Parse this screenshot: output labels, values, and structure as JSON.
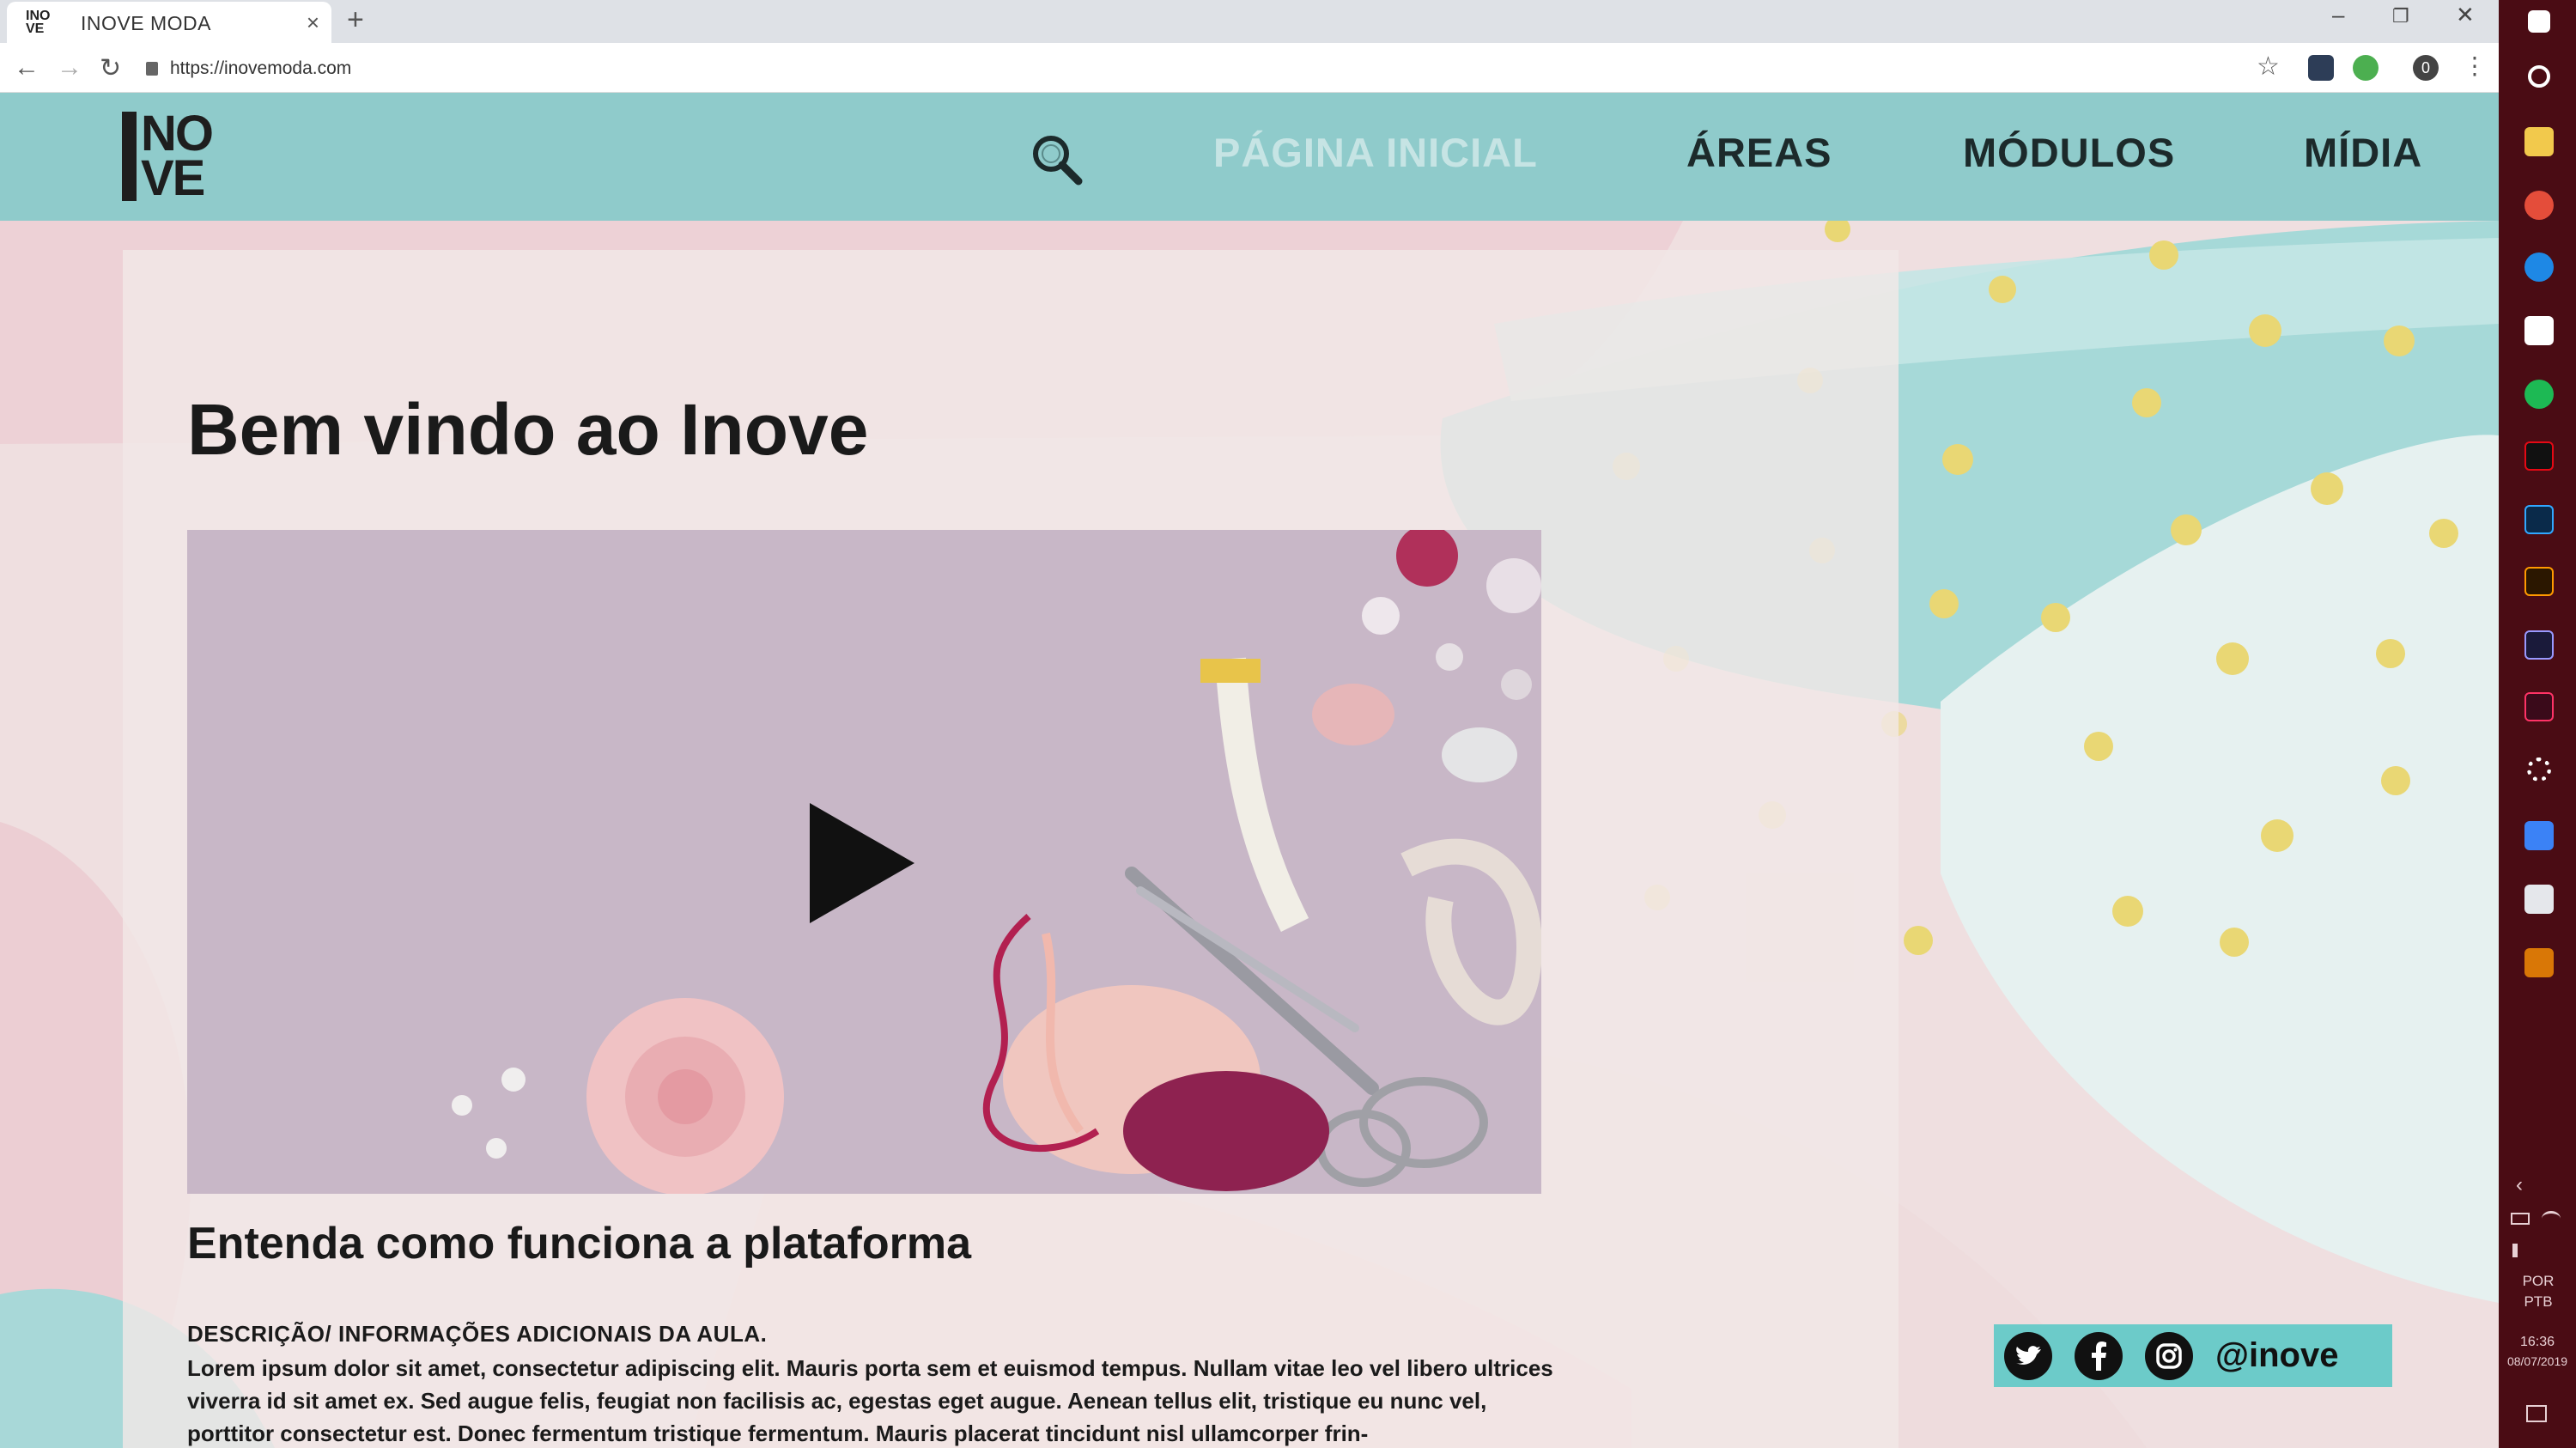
{
  "browser": {
    "tab_title": "INOVE MODA",
    "tab_close": "×",
    "new_tab": "+",
    "url": "https://inovemoda.com",
    "favicon_top": "INO",
    "favicon_bottom": "VE",
    "nav_back": "←",
    "nav_forward": "→",
    "nav_reload": "↻",
    "minimize": "–",
    "restore": "❐",
    "close": "✕",
    "star": "☆",
    "menu": "⋮",
    "profile": "0"
  },
  "site": {
    "logo_line1": "NO",
    "logo_line2": "VE",
    "nav": {
      "home": "PÁGINA INICIAL",
      "areas": "ÁREAS",
      "modulos": "MÓDULOS",
      "midia": "MÍDIA"
    },
    "welcome_title": "Bem vindo ao Inove",
    "video_title": "Entenda como funciona a plataforma",
    "description_heading": "DESCRIÇÃO/ INFORMAÇÕES ADICIONAIS DA AULA.",
    "description_body": "Lorem ipsum dolor sit amet, consectetur adipiscing elit. Mauris porta sem et euismod tempus. Nullam vitae leo vel libero ultrices viverra id sit amet ex. Sed augue felis, feugiat non facilisis ac, egestas eget augue. Aenean tellus elit, tristique eu nunc vel, porttitor consectetur est. Donec fermentum tristique fermentum. Mauris placerat tincidunt nisl ullamcorper frin-",
    "social_handle": "@inove",
    "social_icons": [
      "twitter-icon",
      "facebook-icon",
      "instagram-icon"
    ]
  },
  "taskbar": {
    "lang_1": "POR",
    "lang_2": "PTB",
    "time": "16:36",
    "date": "08/07/2019"
  },
  "colors": {
    "nav_bg": "#8fcbcb",
    "nav_active": "#c6e4e4",
    "page_bg": "#efdfe0",
    "teal_stroke": "#8fcfd0",
    "dot_yellow": "#e9d774",
    "social_bg": "#6ccbc9",
    "taskbar_bg": "#4a0c14"
  }
}
